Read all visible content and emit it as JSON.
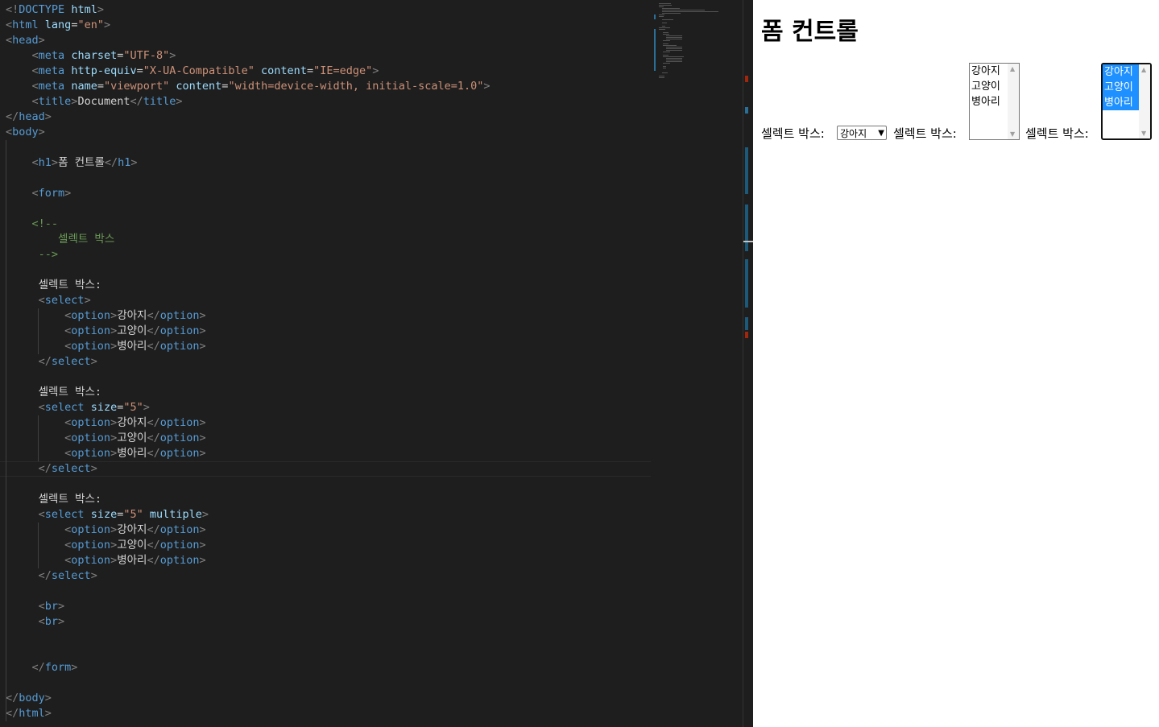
{
  "code_lines": [
    [
      [
        "tk-br",
        "<!"
      ],
      [
        "tk-tag",
        "DOCTYPE"
      ],
      [
        "tk-txt",
        " "
      ],
      [
        "tk-attr",
        "html"
      ],
      [
        "tk-br",
        ">"
      ]
    ],
    [
      [
        "tk-br",
        "<"
      ],
      [
        "tk-tag",
        "html"
      ],
      [
        "tk-txt",
        " "
      ],
      [
        "tk-attr",
        "lang"
      ],
      [
        "tk-eq",
        "="
      ],
      [
        "tk-val",
        "\"en\""
      ],
      [
        "tk-br",
        ">"
      ]
    ],
    [
      [
        "tk-br",
        "<"
      ],
      [
        "tk-tag",
        "head"
      ],
      [
        "tk-br",
        ">"
      ]
    ],
    [
      [
        "tk-txt",
        "    "
      ],
      [
        "tk-br",
        "<"
      ],
      [
        "tk-tag",
        "meta"
      ],
      [
        "tk-txt",
        " "
      ],
      [
        "tk-attr",
        "charset"
      ],
      [
        "tk-eq",
        "="
      ],
      [
        "tk-val",
        "\"UTF-8\""
      ],
      [
        "tk-br",
        ">"
      ]
    ],
    [
      [
        "tk-txt",
        "    "
      ],
      [
        "tk-br",
        "<"
      ],
      [
        "tk-tag",
        "meta"
      ],
      [
        "tk-txt",
        " "
      ],
      [
        "tk-attr",
        "http-equiv"
      ],
      [
        "tk-eq",
        "="
      ],
      [
        "tk-val",
        "\"X-UA-Compatible\""
      ],
      [
        "tk-txt",
        " "
      ],
      [
        "tk-attr",
        "content"
      ],
      [
        "tk-eq",
        "="
      ],
      [
        "tk-val",
        "\"IE=edge\""
      ],
      [
        "tk-br",
        ">"
      ]
    ],
    [
      [
        "tk-txt",
        "    "
      ],
      [
        "tk-br",
        "<"
      ],
      [
        "tk-tag",
        "meta"
      ],
      [
        "tk-txt",
        " "
      ],
      [
        "tk-attr",
        "name"
      ],
      [
        "tk-eq",
        "="
      ],
      [
        "tk-val",
        "\"viewport\""
      ],
      [
        "tk-txt",
        " "
      ],
      [
        "tk-attr",
        "content"
      ],
      [
        "tk-eq",
        "="
      ],
      [
        "tk-val",
        "\"width=device-width, initial-scale=1.0\""
      ],
      [
        "tk-br",
        ">"
      ]
    ],
    [
      [
        "tk-txt",
        "    "
      ],
      [
        "tk-br",
        "<"
      ],
      [
        "tk-tag",
        "title"
      ],
      [
        "tk-br",
        ">"
      ],
      [
        "tk-txt",
        "Document"
      ],
      [
        "tk-br",
        "</"
      ],
      [
        "tk-tag",
        "title"
      ],
      [
        "tk-br",
        ">"
      ]
    ],
    [
      [
        "tk-br",
        "</"
      ],
      [
        "tk-tag",
        "head"
      ],
      [
        "tk-br",
        ">"
      ]
    ],
    [
      [
        "tk-br",
        "<"
      ],
      [
        "tk-tag",
        "body"
      ],
      [
        "tk-br",
        ">"
      ]
    ],
    [],
    [
      [
        "tk-txt",
        "    "
      ],
      [
        "tk-br",
        "<"
      ],
      [
        "tk-tag",
        "h1"
      ],
      [
        "tk-br",
        ">"
      ],
      [
        "tk-txt",
        "폼 컨트롤"
      ],
      [
        "tk-br",
        "</"
      ],
      [
        "tk-tag",
        "h1"
      ],
      [
        "tk-br",
        ">"
      ]
    ],
    [],
    [
      [
        "tk-txt",
        "    "
      ],
      [
        "tk-br",
        "<"
      ],
      [
        "tk-tag",
        "form"
      ],
      [
        "tk-br",
        ">"
      ]
    ],
    [],
    [
      [
        "tk-txt",
        "    "
      ],
      [
        "tk-cmt",
        "<!--"
      ]
    ],
    [
      [
        "tk-cmt",
        "        셀렉트 박스"
      ]
    ],
    [
      [
        "tk-cmt",
        "     -->"
      ]
    ],
    [],
    [
      [
        "tk-txt",
        "     셀렉트 박스:"
      ]
    ],
    [
      [
        "tk-txt",
        "     "
      ],
      [
        "tk-br",
        "<"
      ],
      [
        "tk-tag",
        "select"
      ],
      [
        "tk-br",
        ">"
      ]
    ],
    [
      [
        "tk-txt",
        "         "
      ],
      [
        "tk-br",
        "<"
      ],
      [
        "tk-tag",
        "option"
      ],
      [
        "tk-br",
        ">"
      ],
      [
        "tk-txt",
        "강아지"
      ],
      [
        "tk-br",
        "</"
      ],
      [
        "tk-tag",
        "option"
      ],
      [
        "tk-br",
        ">"
      ]
    ],
    [
      [
        "tk-txt",
        "         "
      ],
      [
        "tk-br",
        "<"
      ],
      [
        "tk-tag",
        "option"
      ],
      [
        "tk-br",
        ">"
      ],
      [
        "tk-txt",
        "고양이"
      ],
      [
        "tk-br",
        "</"
      ],
      [
        "tk-tag",
        "option"
      ],
      [
        "tk-br",
        ">"
      ]
    ],
    [
      [
        "tk-txt",
        "         "
      ],
      [
        "tk-br",
        "<"
      ],
      [
        "tk-tag",
        "option"
      ],
      [
        "tk-br",
        ">"
      ],
      [
        "tk-txt",
        "병아리"
      ],
      [
        "tk-br",
        "</"
      ],
      [
        "tk-tag",
        "option"
      ],
      [
        "tk-br",
        ">"
      ]
    ],
    [
      [
        "tk-txt",
        "     "
      ],
      [
        "tk-br",
        "</"
      ],
      [
        "tk-tag",
        "select"
      ],
      [
        "tk-br",
        ">"
      ]
    ],
    [],
    [
      [
        "tk-txt",
        "     셀렉트 박스:"
      ]
    ],
    [
      [
        "tk-txt",
        "     "
      ],
      [
        "tk-br",
        "<"
      ],
      [
        "tk-tag",
        "select"
      ],
      [
        "tk-txt",
        " "
      ],
      [
        "tk-attr",
        "size"
      ],
      [
        "tk-eq",
        "="
      ],
      [
        "tk-val",
        "\"5\""
      ],
      [
        "tk-br",
        ">"
      ]
    ],
    [
      [
        "tk-txt",
        "         "
      ],
      [
        "tk-br",
        "<"
      ],
      [
        "tk-tag",
        "option"
      ],
      [
        "tk-br",
        ">"
      ],
      [
        "tk-txt",
        "강아지"
      ],
      [
        "tk-br",
        "</"
      ],
      [
        "tk-tag",
        "option"
      ],
      [
        "tk-br",
        ">"
      ]
    ],
    [
      [
        "tk-txt",
        "         "
      ],
      [
        "tk-br",
        "<"
      ],
      [
        "tk-tag",
        "option"
      ],
      [
        "tk-br",
        ">"
      ],
      [
        "tk-txt",
        "고양이"
      ],
      [
        "tk-br",
        "</"
      ],
      [
        "tk-tag",
        "option"
      ],
      [
        "tk-br",
        ">"
      ]
    ],
    [
      [
        "tk-txt",
        "         "
      ],
      [
        "tk-br",
        "<"
      ],
      [
        "tk-tag",
        "option"
      ],
      [
        "tk-br",
        ">"
      ],
      [
        "tk-txt",
        "병아리"
      ],
      [
        "tk-br",
        "</"
      ],
      [
        "tk-tag",
        "option"
      ],
      [
        "tk-br",
        ">"
      ]
    ],
    [
      [
        "tk-txt",
        "     "
      ],
      [
        "tk-br",
        "</"
      ],
      [
        "tk-tag",
        "select"
      ],
      [
        "tk-br",
        ">"
      ]
    ],
    [],
    [
      [
        "tk-txt",
        "     셀렉트 박스:"
      ]
    ],
    [
      [
        "tk-txt",
        "     "
      ],
      [
        "tk-br",
        "<"
      ],
      [
        "tk-tag",
        "select"
      ],
      [
        "tk-txt",
        " "
      ],
      [
        "tk-attr",
        "size"
      ],
      [
        "tk-eq",
        "="
      ],
      [
        "tk-val",
        "\"5\""
      ],
      [
        "tk-txt",
        " "
      ],
      [
        "tk-attr",
        "multiple"
      ],
      [
        "tk-br",
        ">"
      ]
    ],
    [
      [
        "tk-txt",
        "         "
      ],
      [
        "tk-br",
        "<"
      ],
      [
        "tk-tag",
        "option"
      ],
      [
        "tk-br",
        ">"
      ],
      [
        "tk-txt",
        "강아지"
      ],
      [
        "tk-br",
        "</"
      ],
      [
        "tk-tag",
        "option"
      ],
      [
        "tk-br",
        ">"
      ]
    ],
    [
      [
        "tk-txt",
        "         "
      ],
      [
        "tk-br",
        "<"
      ],
      [
        "tk-tag",
        "option"
      ],
      [
        "tk-br",
        ">"
      ],
      [
        "tk-txt",
        "고양이"
      ],
      [
        "tk-br",
        "</"
      ],
      [
        "tk-tag",
        "option"
      ],
      [
        "tk-br",
        ">"
      ]
    ],
    [
      [
        "tk-txt",
        "         "
      ],
      [
        "tk-br",
        "<"
      ],
      [
        "tk-tag",
        "option"
      ],
      [
        "tk-br",
        ">"
      ],
      [
        "tk-txt",
        "병아리"
      ],
      [
        "tk-br",
        "</"
      ],
      [
        "tk-tag",
        "option"
      ],
      [
        "tk-br",
        ">"
      ]
    ],
    [
      [
        "tk-txt",
        "     "
      ],
      [
        "tk-br",
        "</"
      ],
      [
        "tk-tag",
        "select"
      ],
      [
        "tk-br",
        ">"
      ]
    ],
    [],
    [
      [
        "tk-txt",
        "     "
      ],
      [
        "tk-br",
        "<"
      ],
      [
        "tk-tag",
        "br"
      ],
      [
        "tk-br",
        ">"
      ]
    ],
    [
      [
        "tk-txt",
        "     "
      ],
      [
        "tk-br",
        "<"
      ],
      [
        "tk-tag",
        "br"
      ],
      [
        "tk-br",
        ">"
      ]
    ],
    [],
    [],
    [
      [
        "tk-txt",
        "    "
      ],
      [
        "tk-br",
        "</"
      ],
      [
        "tk-tag",
        "form"
      ],
      [
        "tk-br",
        ">"
      ]
    ],
    [],
    [
      [
        "tk-br",
        "</"
      ],
      [
        "tk-tag",
        "body"
      ],
      [
        "tk-br",
        ">"
      ]
    ],
    [
      [
        "tk-br",
        "</"
      ],
      [
        "tk-tag",
        "html"
      ],
      [
        "tk-br",
        ">"
      ]
    ]
  ],
  "preview": {
    "heading": "폼 컨트롤",
    "label1": "셀렉트 박스:",
    "label2": "셀렉트 박스:",
    "label3": "셀렉트 박스:",
    "dropdown_selected": "강아지",
    "listbox_options": [
      "강아지",
      "고양이",
      "병아리"
    ],
    "multi_options": [
      "강아지",
      "고양이",
      "병아리"
    ],
    "multi_selected": [
      true,
      true,
      true
    ]
  },
  "colors": {
    "editor_bg": "#1e1e1e",
    "tag": "#569cd6",
    "attr": "#9cdcfe",
    "string": "#ce9178",
    "comment": "#6a9955",
    "selection": "#1e90ff"
  }
}
